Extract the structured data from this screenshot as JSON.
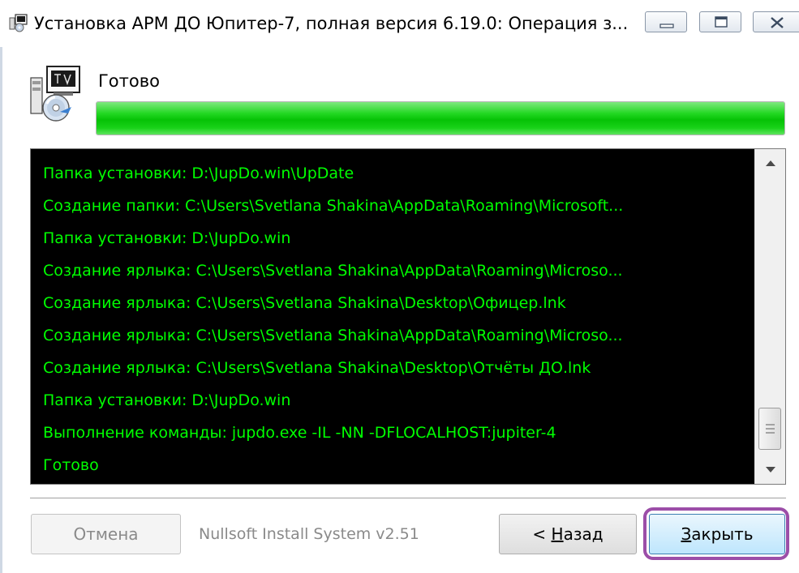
{
  "window": {
    "title": "Установка АРМ ДО Юпитер-7, полная версия 6.19.0: Операция з..."
  },
  "header": {
    "status": "Готово",
    "progress_percent": 100,
    "progress_color": "#00c800"
  },
  "log": {
    "text_color": "#00ff00",
    "background": "#000000",
    "lines": [
      "Папка установки: D:\\JupDo.win\\UpDate",
      "Создание папки: C:\\Users\\Svetlana Shakina\\AppData\\Roaming\\Microsoft...",
      "Папка установки: D:\\JupDo.win",
      "Создание ярлыка: C:\\Users\\Svetlana Shakina\\AppData\\Roaming\\Microso...",
      "Создание ярлыка: C:\\Users\\Svetlana Shakina\\Desktop\\Офицер.lnk",
      "Создание ярлыка: C:\\Users\\Svetlana Shakina\\AppData\\Roaming\\Microso...",
      "Создание ярлыка: C:\\Users\\Svetlana Shakina\\Desktop\\Отчёты ДО.lnk",
      "Папка установки: D:\\JupDo.win",
      "Выполнение команды: jupdo.exe -IL -NN -DFLOCALHOST:jupiter-4",
      "Готово"
    ]
  },
  "footer": {
    "cancel_label": "Отмена",
    "branding": "Nullsoft Install System v2.51",
    "back_prefix": "< ",
    "back_mnemonic": "Н",
    "back_rest": "азад",
    "close_mnemonic": "З",
    "close_rest": "акрыть",
    "highlight_color": "#9c4ea8"
  }
}
